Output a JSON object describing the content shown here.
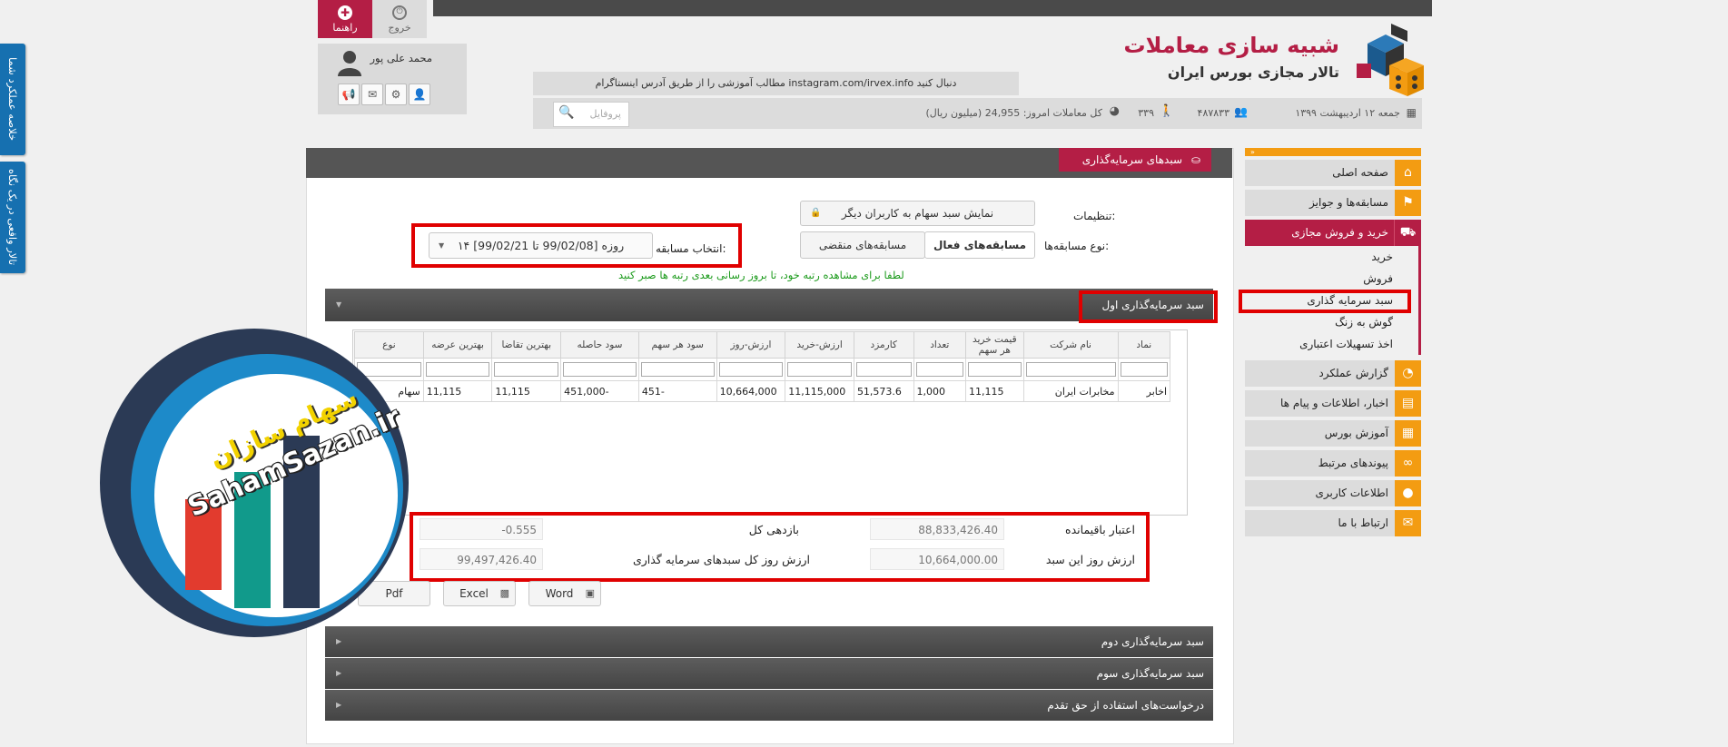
{
  "side_tabs": [
    "خلاصه عملکرد شما",
    "تالار واقعی در یک نگاه"
  ],
  "header": {
    "logo_title": "شبیه سازی معاملات",
    "logo_subtitle": "تالار مجازی بورس ایران",
    "exit_label": "خروج",
    "help_label": "راهنما",
    "user_name": "محمد علی پور",
    "notice": "مطالب آموزشی را از طریق آدرس اینستاگرام instagram.com/irvex.info دنبال کنید",
    "date": "جمعه ۱۲ اردیبهشت ۱۳۹۹",
    "members": "۴۸۷۸۳۳",
    "online": "۳۳۹",
    "trades": "کل معاملات امروز: 24,955 (میلیون ریال)",
    "search_placeholder": "پروفایل"
  },
  "menu": {
    "items": [
      {
        "label": "صفحه اصلی",
        "icon": "home-icon",
        "glyph": "⌂"
      },
      {
        "label": "مسابقه‌ها و جوایز",
        "icon": "flag-icon",
        "glyph": "⚑"
      },
      {
        "label": "خرید و فروش مجازی",
        "icon": "cart-icon",
        "glyph": "🛒"
      },
      {
        "label": "گزارش عملکرد",
        "icon": "pie-chart-icon",
        "glyph": "◔"
      },
      {
        "label": "اخبار، اطلاعات و پیام ها",
        "icon": "news-icon",
        "glyph": "▤"
      },
      {
        "label": "آموزش بورس",
        "icon": "book-icon",
        "glyph": "▦"
      },
      {
        "label": "پیوندهای مرتبط",
        "icon": "link-icon",
        "glyph": "∞"
      },
      {
        "label": "اطلاعات کاربری",
        "icon": "user-icon",
        "glyph": "●"
      },
      {
        "label": "ارتباط با ما",
        "icon": "mail-icon",
        "glyph": "✉"
      }
    ],
    "sub_items": [
      "خرید",
      "فروش",
      "سبد سرمایه گذاری",
      "گوش به زنگ",
      "اخذ تسهیلات اعتباری"
    ]
  },
  "panel": {
    "title": "سبدهای سرمایه‌گذاری",
    "settings_label": "تنظیمات:",
    "show_basket_btn": "نمایش سبد سهام به کاربران دیگر",
    "contest_type_label": "نوع مسابقه‌ها:",
    "active_btn": "مسابقه‌های فعال",
    "expired_btn": "مسابقه‌های منقضی",
    "select_label": "انتخاب مسابقه:",
    "select_value": "۱۴ روزه [99/02/08 تا 99/02/21]",
    "hint": "لطفا برای مشاهده رتبه خود، تا بروز رسانی بعدی رتبه ها صبر کنید",
    "acc_first": "سبد سرمایه‌گذاری اول",
    "acc_second": "سبد سرمایه‌گذاری دوم",
    "acc_third": "سبد سرمایه‌گذاری سوم",
    "acc_requests": "درخواست‌های استفاده از حق تقدم"
  },
  "table": {
    "columns": [
      "نماد",
      "نام شرکت",
      "قیمت خرید هر سهم",
      "تعداد",
      "کارمزد",
      "ارزش-خرید",
      "ارزش-روز",
      "سود هر سهم",
      "سود حاصله",
      "بهترین تقاضا",
      "بهترین عرضه",
      "نوع"
    ],
    "rows": [
      [
        "اخابر",
        "مخابرات ایران",
        "11,115",
        "1,000",
        "51,573.6",
        "11,115,000",
        "10,664,000",
        "-451",
        "-451,000",
        "11,115",
        "11,115",
        "سهام"
      ]
    ]
  },
  "summary": {
    "remaining_credit_label": "اعتبار باقیمانده",
    "remaining_credit_value": "88,833,426.40",
    "total_return_label": "بازدهی کل",
    "total_return_value": "-0.555",
    "basket_value_label": "ارزش روز این سبد",
    "basket_value_value": "10,664,000.00",
    "all_baskets_label": "ارزش روز کل سبدهای سرمایه گذاری",
    "all_baskets_value": "99,497,426.40"
  },
  "export": {
    "word": "Word",
    "excel": "Excel",
    "pdf": "Pdf"
  },
  "watermark": {
    "text_fa": "سهام سازان",
    "text_en": "SahamSazan.ir"
  },
  "colors": {
    "brand": "#b41e45",
    "menu_accent": "#f39c12",
    "side_tab": "#1670b0",
    "highlight": "#e00000"
  }
}
